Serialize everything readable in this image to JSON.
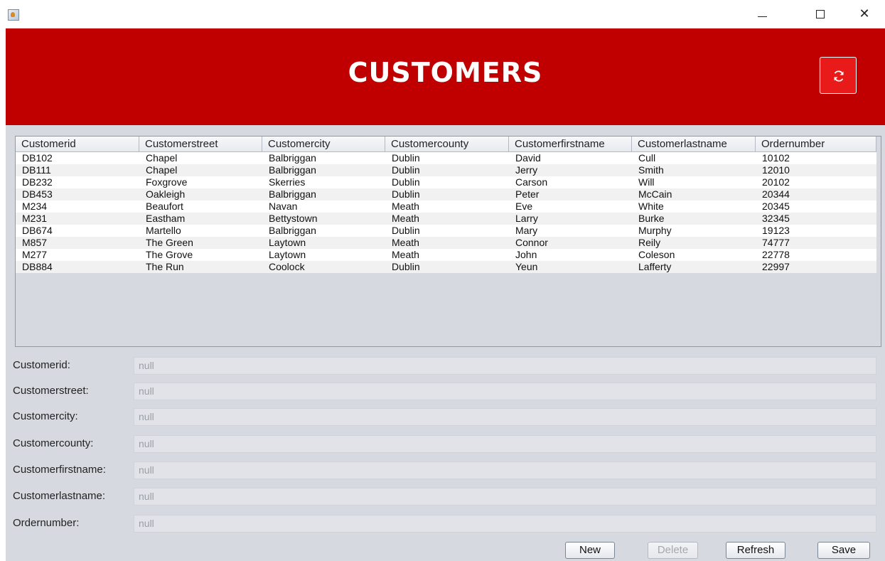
{
  "window": {
    "icon": "java-app-icon",
    "controls": {
      "minimize": "minimize-icon",
      "maximize": "maximize-icon",
      "close": "✕"
    }
  },
  "header": {
    "title": "CUSTOMERS",
    "background": "#c00000",
    "refresh_icon": "refresh-icon"
  },
  "table": {
    "columns": [
      "Customerid",
      "Customerstreet",
      "Customercity",
      "Customercounty",
      "Customerfirstname",
      "Customerlastname",
      "Ordernumber"
    ],
    "rows": [
      [
        "DB102",
        "Chapel",
        "Balbriggan",
        "Dublin",
        "David",
        "Cull",
        "10102"
      ],
      [
        "DB111",
        "Chapel",
        "Balbriggan",
        "Dublin",
        "Jerry",
        "Smith",
        "12010"
      ],
      [
        "DB232",
        "Foxgrove",
        "Skerries",
        "Dublin",
        "Carson",
        "Will",
        "20102"
      ],
      [
        "DB453",
        "Oakleigh",
        "Balbriggan",
        "Dublin",
        "Peter",
        "McCain",
        "20344"
      ],
      [
        "M234",
        "Beaufort",
        "Navan",
        "Meath",
        "Eve",
        "White",
        "20345"
      ],
      [
        "M231",
        "Eastham",
        "Bettystown",
        "Meath",
        "Larry",
        "Burke",
        "32345"
      ],
      [
        "DB674",
        "Martello",
        "Balbriggan",
        "Dublin",
        "Mary",
        "Murphy",
        "19123"
      ],
      [
        "M857",
        "The Green",
        "Laytown",
        "Meath",
        "Connor",
        "Reily",
        "74777"
      ],
      [
        "M277",
        "The Grove",
        "Laytown",
        "Meath",
        "John",
        "Coleson",
        "22778"
      ],
      [
        "DB884",
        "The Run",
        "Coolock",
        "Dublin",
        "Yeun",
        "Lafferty",
        "22997"
      ]
    ]
  },
  "form": {
    "fields": [
      {
        "label": "Customerid:",
        "value": "null"
      },
      {
        "label": "Customerstreet:",
        "value": "null"
      },
      {
        "label": "Customercity:",
        "value": "null"
      },
      {
        "label": "Customercounty:",
        "value": "null"
      },
      {
        "label": "Customerfirstname:",
        "value": "null"
      },
      {
        "label": "Customerlastname:",
        "value": "null"
      },
      {
        "label": "Ordernumber:",
        "value": "null"
      }
    ]
  },
  "buttons": {
    "new": "New",
    "delete": "Delete",
    "refresh": "Refresh",
    "save": "Save"
  }
}
